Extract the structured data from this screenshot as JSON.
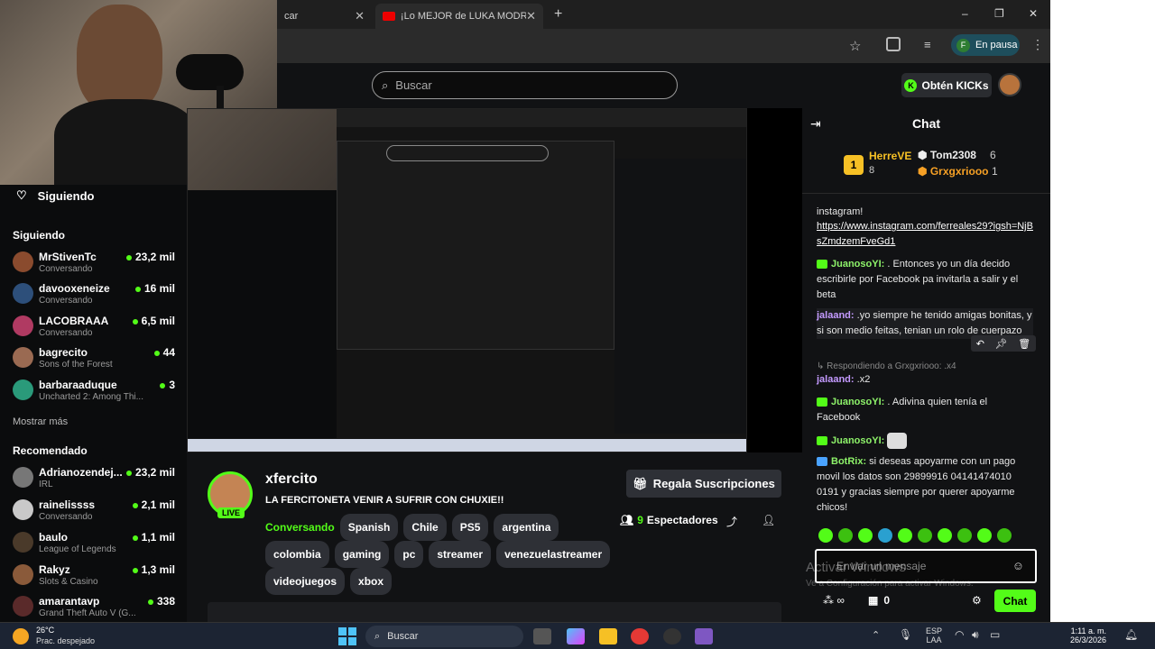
{
  "browser": {
    "tabs": [
      {
        "title": "car"
      },
      {
        "title": "¡Lo MEJOR de LUKA MODRIĆ!"
      }
    ],
    "new_tab": "+",
    "profile_label": "En pausa",
    "profile_initial": "F",
    "win_controls": [
      "–",
      "❐",
      "✕"
    ]
  },
  "header": {
    "search_placeholder": "Buscar",
    "kicks_label": "Obtén KICKs"
  },
  "sidebar": {
    "following_title": "Siguiendo",
    "section_following": "Siguiendo",
    "following": [
      {
        "name": "MrStivenTc",
        "sub": "Conversando",
        "viewers": "23,2 mil"
      },
      {
        "name": "davooxeneize",
        "sub": "Conversando",
        "viewers": "16 mil"
      },
      {
        "name": "LACOBRAAA",
        "sub": "Conversando",
        "viewers": "6,5 mil"
      },
      {
        "name": "bagrecito",
        "sub": "Sons of the Forest",
        "viewers": "44"
      },
      {
        "name": "barbaraaduque",
        "sub": "Uncharted 2: Among Thi...",
        "viewers": "3"
      }
    ],
    "show_more": "Mostrar más",
    "section_recommended": "Recomendado",
    "recommended": [
      {
        "name": "Adrianozendej...",
        "sub": "IRL",
        "viewers": "23,2 mil"
      },
      {
        "name": "rainelissss",
        "sub": "Conversando",
        "viewers": "2,1 mil"
      },
      {
        "name": "baulo",
        "sub": "League of Legends",
        "viewers": "1,1 mil"
      },
      {
        "name": "Rakyz",
        "sub": "Slots & Casino",
        "viewers": "1,3 mil"
      },
      {
        "name": "amarantavp",
        "sub": "Grand Theft Auto V (G...",
        "viewers": "338"
      }
    ]
  },
  "stream": {
    "channel": "xfercito",
    "live": "LIVE",
    "title": "LA FERCITONETA VENIR A SUFRIR CON CHUXIE!!",
    "category": "Conversando",
    "tags": [
      "Spanish",
      "Chile",
      "PS5",
      "argentina",
      "colombia",
      "gaming",
      "pc",
      "streamer",
      "venezuelastreamer",
      "videojuegos",
      "xbox"
    ],
    "gift_button": "Regala Suscripciones",
    "viewers": "9",
    "viewers_label": "Espectadores"
  },
  "chat": {
    "title": "Chat",
    "leaderboard": [
      {
        "rank": "1",
        "name": "HerreVE",
        "count": "8"
      },
      {
        "name": "Tom2308",
        "count": "6"
      },
      {
        "name": "Grxgxriooo",
        "count": "1"
      }
    ],
    "messages": [
      {
        "user": "",
        "text": "instagram!"
      },
      {
        "user": "",
        "text": "https://www.instagram.com/ferreales29?igsh=NjBsZmdzemFveGd1",
        "link": true
      },
      {
        "user": "JuanosoYI:",
        "text": ". Entonces yo un día decido escribirle por Facebook pa invitarla a salir y el beta"
      },
      {
        "user": "jalaand:",
        "text": ".yo siempre he tenido amigas bonitas, y si son medio feitas, tenian un rolo de cuerpazo"
      },
      {
        "user": "",
        "text": "Respondiendo a Grxgxriooo: .x4"
      },
      {
        "user": "jalaand:",
        "text": ".x2"
      },
      {
        "user": "JuanosoYI:",
        "text": ". Adivina quien tenía el Facebook"
      },
      {
        "user": "JuanosoYI:",
        "text": ""
      },
      {
        "user": "BotRix:",
        "text": "si deseas apoyarme con un pago movil los datos son 29899916 04141474010 0191 y gracias siempre por querer apoyarme chicos!"
      }
    ],
    "input_placeholder": "Enviar un mensaje",
    "watermark_line1": "Activar Windows",
    "watermark_line2": "Ve a Configuración para activar Windows.",
    "points": "0",
    "send": "Chat"
  },
  "taskbar": {
    "weather_temp": "26°C",
    "weather_desc": "Prac. despejado",
    "search": "Buscar",
    "lang1": "ESP",
    "lang2": "LAA",
    "time": "1:11 a. m.",
    "date": "26/3/2026"
  },
  "colors": {
    "accent": "#53fc18",
    "bg": "#111214"
  }
}
